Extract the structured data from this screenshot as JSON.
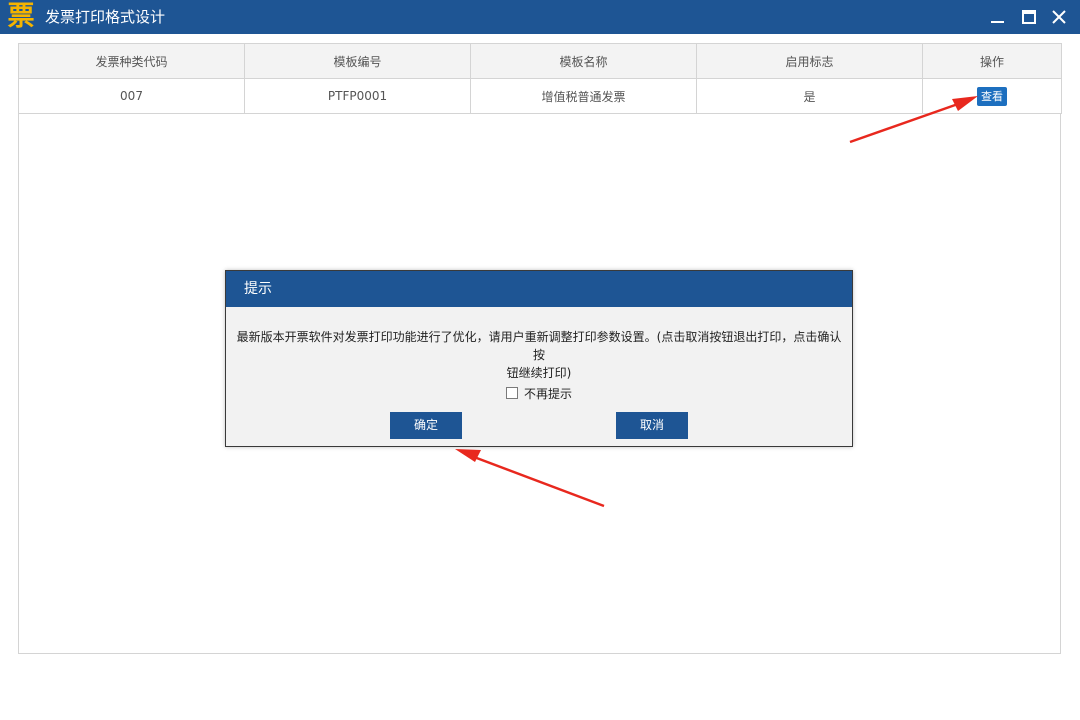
{
  "window": {
    "logo_char": "票",
    "title": "发票打印格式设计",
    "controls": [
      "minimize-icon",
      "maximize-icon",
      "close-icon"
    ]
  },
  "table": {
    "columns": [
      "发票种类代码",
      "模板编号",
      "模板名称",
      "启用标志",
      "操作"
    ],
    "rows": [
      {
        "code": "007",
        "template_no": "PTFP0001",
        "template_name": "增值税普通发票",
        "enabled": "是",
        "action": "查看"
      }
    ]
  },
  "dialog": {
    "title": "提示",
    "message_line1": "最新版本开票软件对发票打印功能进行了优化，请用户重新调整打印参数设置。(点击取消按钮退出打印，点击确认按",
    "message_line2": "钮继续打印)",
    "checkbox_label": "不再提示",
    "checkbox_checked": false,
    "confirm_label": "确定",
    "cancel_label": "取消"
  },
  "colors": {
    "titlebar": "#1e5594",
    "logo": "#f4b400",
    "view_button": "#1d6fbf",
    "annotation_arrow": "#e8281e"
  }
}
